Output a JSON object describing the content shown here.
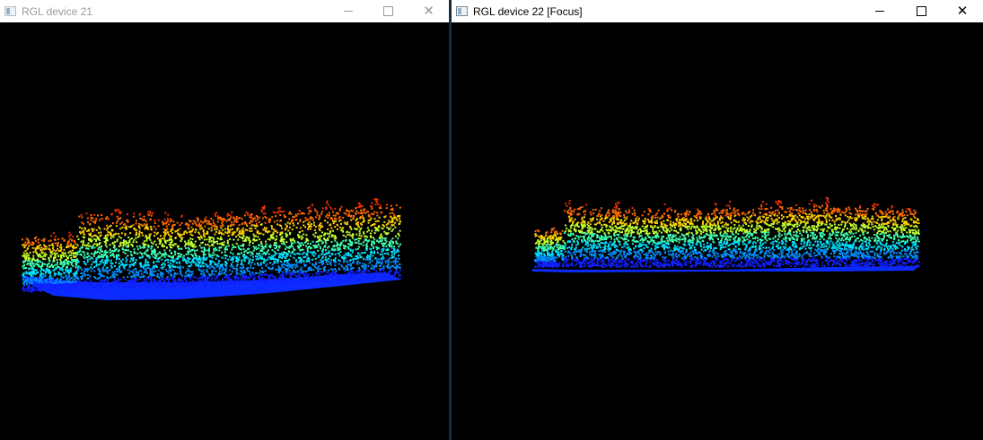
{
  "windows": [
    {
      "title": "RGL device 21",
      "focused": false,
      "controls": {
        "minimize": "minimize-icon",
        "maximize": "maximize-icon",
        "close": "close-icon"
      }
    },
    {
      "title": "RGL device 22 [Focus]",
      "focused": true,
      "controls": {
        "minimize": "minimize-icon",
        "maximize": "maximize-icon",
        "close": "close-icon"
      }
    }
  ],
  "colors": {
    "background": "#000000",
    "titlebar": "#ffffff",
    "window_divider": "#1d2b3a",
    "height_ramp": [
      "#1020ff",
      "#0090ff",
      "#00e0ff",
      "#40ffb0",
      "#c0ff30",
      "#ffd000",
      "#ff6a00",
      "#e83000"
    ]
  }
}
